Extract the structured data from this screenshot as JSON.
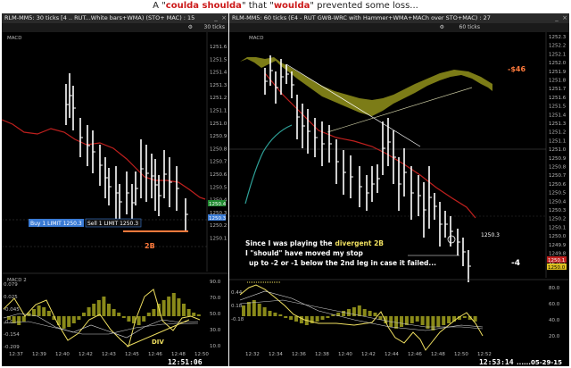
{
  "headline": {
    "prefix": "A",
    "h1": "coulda shoulda",
    "mid": "that",
    "h2": "woulda",
    "suffix": "prevented some loss..."
  },
  "left": {
    "title": "RLM-MM5: 30 ticks [4 .. RUT...White bars+WMA) (STO+ MAC) : 15",
    "ticks_label": "30 ticks",
    "panel_label": "MACD",
    "price_axis": [
      "1251.6",
      "1251.5",
      "1251.4",
      "1251.3",
      "1251.2",
      "1251.1",
      "1251.0",
      "1250.9",
      "1250.8",
      "1250.7",
      "1250.6",
      "1250.5",
      "1250.4",
      "1250.3",
      "1250.2",
      "1250.1"
    ],
    "buy_order": "Buy 1 LIMIT 1250.3",
    "sell_order": "Sell 1 LIMIT 1250.3",
    "tag_green": "1250.4",
    "tag_blue": "1250.3",
    "annot_2b": "2B",
    "indicator_label": "MACD 2",
    "left_axis": [
      "0.079",
      "0.025",
      "-0.045",
      "-0.084",
      "-0.154",
      "-0.209"
    ],
    "right_axis": [
      "90.0",
      "70.0",
      "50.0",
      "30.0",
      "10.0"
    ],
    "annot_div": "DIV",
    "time_axis": [
      "12:37",
      "12:39",
      "12:40",
      "12:42",
      "12:43",
      "12:45",
      "12:46",
      "12:48",
      "12:50"
    ],
    "clock": "12:51:06"
  },
  "right": {
    "title": "RLM-MM5: 60 ticks (E4 - RUT GWB-WRC with Hammer+WMA+MACh over STO+MAC) : 27",
    "ticks_label": "60 ticks",
    "panel_label": "MACD",
    "price_axis": [
      "1252.3",
      "1252.2",
      "1252.1",
      "1252.0",
      "1251.9",
      "1251.8",
      "1251.7",
      "1251.6",
      "1251.5",
      "1251.4",
      "1251.3",
      "1251.2",
      "1251.1",
      "1251.0",
      "1250.9",
      "1250.8",
      "1250.7",
      "1250.6",
      "1250.5",
      "1250.4",
      "1250.3",
      "1250.2",
      "1250.1",
      "1250.0",
      "1249.9",
      "1249.8",
      "1249.7"
    ],
    "annot_46": "-$46",
    "price_tag": "1250.3",
    "annot_4": "-4",
    "tag_red": "1250.1",
    "tag_yellow": "1250.0",
    "note_line1_a": "Since I was playing the",
    "note_line1_b": "divergent 2B",
    "note_line2": "I \"should\" have moved my stop",
    "note_line3": "up to -2 or -1 below the 2nd leg in case it failed...",
    "left_axis": [
      "0.44",
      "0.18",
      "-0.18"
    ],
    "right_axis": [
      "80.0",
      "60.0",
      "40.0",
      "20.0"
    ],
    "time_axis": [
      "12:32",
      "12:34",
      "12:36",
      "12:38",
      "12:40",
      "12:42",
      "12:44",
      "12:46",
      "12:48",
      "12:50",
      "12:52"
    ],
    "clock": "12:53:14",
    "date": "......05-29-15"
  },
  "colors": {
    "bg": "#000000",
    "bars": "#ffffff",
    "wma_red": "#c0201e",
    "teal": "#2fa39a",
    "olive": "#8a8a1a",
    "yellow_line": "#f0e060",
    "orange": "#ff7a3c",
    "blue": "#3a7bd5"
  }
}
